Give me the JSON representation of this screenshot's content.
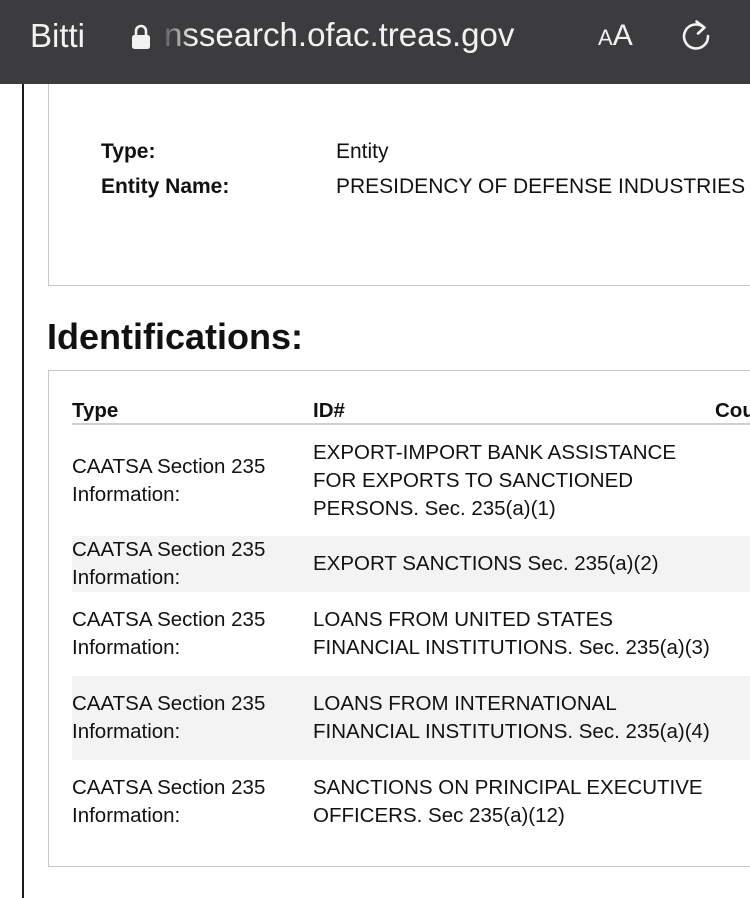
{
  "browser": {
    "back_label": "Bitti",
    "url": "nssearch.ofac.treas.gov",
    "text_size_small": "A",
    "text_size_big": "A"
  },
  "details": {
    "type_label": "Type:",
    "type_value": "Entity",
    "entity_name_label": "Entity Name:",
    "entity_name_value": "PRESIDENCY OF DEFENSE INDUSTRIES"
  },
  "identifications": {
    "heading": "Identifications:",
    "columns": [
      "Type",
      "ID#",
      "Country"
    ],
    "rows": [
      {
        "type": "CAATSA Section 235 Information:",
        "id": "EXPORT-IMPORT BANK ASSISTANCE FOR EXPORTS TO SANCTIONED PERSONS. Sec. 235(a)(1)",
        "country": ""
      },
      {
        "type": "CAATSA Section 235 Information:",
        "id": "EXPORT SANCTIONS Sec. 235(a)(2)",
        "country": ""
      },
      {
        "type": "CAATSA Section 235 Information:",
        "id": "LOANS FROM UNITED STATES FINANCIAL INSTITUTIONS. Sec. 235(a)(3)",
        "country": ""
      },
      {
        "type": "CAATSA Section 235 Information:",
        "id": "LOANS FROM INTERNATIONAL FINANCIAL INSTITUTIONS. Sec. 235(a)(4)",
        "country": ""
      },
      {
        "type": "CAATSA Section 235 Information:",
        "id": "SANCTIONS ON PRINCIPAL EXECUTIVE OFFICERS. Sec 235(a)(12)",
        "country": ""
      }
    ]
  }
}
